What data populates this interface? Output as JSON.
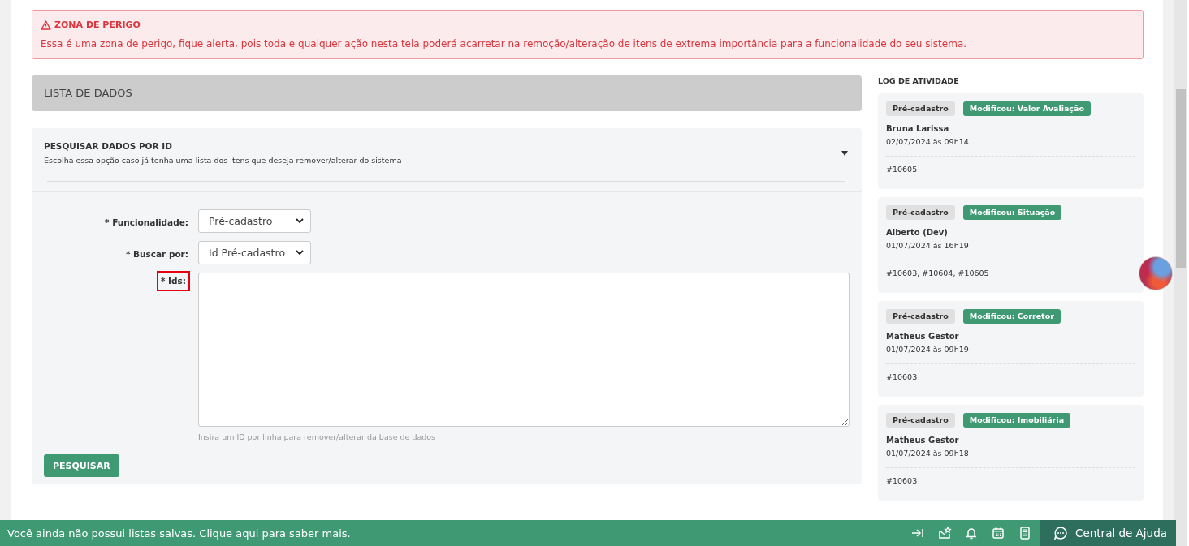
{
  "alert": {
    "title": "ZONA DE PERIGO",
    "message": "Essa é uma zona de perigo, fique alerta, pois toda e qualquer ação nesta tela poderá acarretar na remoção/alteração de itens de extrema importância para a funcionalidade do seu sistema."
  },
  "section_header": "LISTA DE DADOS",
  "search_panel": {
    "title": "PESQUISAR DADOS POR ID",
    "description": "Escolha essa opção caso já tenha uma lista dos itens que deseja remover/alterar do sistema",
    "expanded": true,
    "fields": [
      {
        "kind": "select",
        "label": "* Funcionalidade:",
        "value": "Pré-cadastro",
        "highlighted": false
      },
      {
        "kind": "select",
        "label": "* Buscar por:",
        "value": "Id Pré-cadastro",
        "highlighted": false
      },
      {
        "kind": "textarea",
        "label": "* Ids:",
        "highlighted": true,
        "hint": "Insira um ID por linha para remover/alterar da base de dados"
      }
    ],
    "button": "PESQUISAR"
  },
  "activity_log": {
    "title": "LOG DE ATIVIDADE",
    "entries": [
      {
        "module": "Pré-cadastro",
        "action": "Modificou: Valor Avaliação",
        "user": "Bruna Larissa",
        "datetime": "02/07/2024 às 09h14",
        "ids": "#10605"
      },
      {
        "module": "Pré-cadastro",
        "action": "Modificou: Situação",
        "user": "Alberto (Dev)",
        "datetime": "01/07/2024 às 16h19",
        "ids": "#10603, #10604, #10605"
      },
      {
        "module": "Pré-cadastro",
        "action": "Modificou: Corretor",
        "user": "Matheus Gestor",
        "datetime": "01/07/2024 às 09h19",
        "ids": "#10603"
      },
      {
        "module": "Pré-cadastro",
        "action": "Modificou: Imobiliária",
        "user": "Matheus Gestor",
        "datetime": "01/07/2024 às 09h18",
        "ids": "#10603"
      }
    ]
  },
  "footer": {
    "message": "Você ainda não possui listas salvas. Clique aqui para saber mais.",
    "help_button": "Central de Ajuda"
  }
}
